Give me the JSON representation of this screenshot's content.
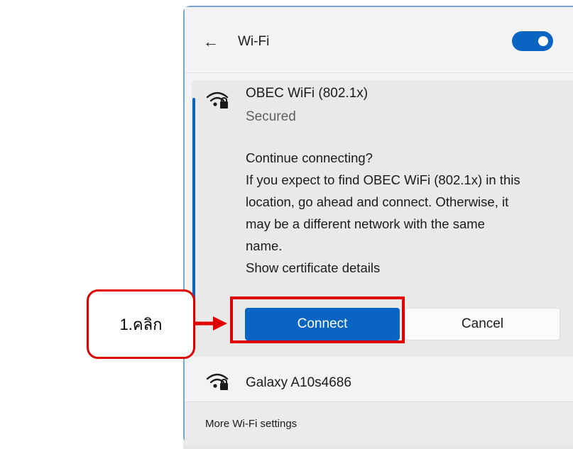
{
  "panel": {
    "title": "Wi-Fi",
    "back_icon": "back-arrow-icon",
    "toggle": {
      "state": "on",
      "icon": "toggle-switch"
    }
  },
  "networks": [
    {
      "name": "OBEC WiFi (802.1x)",
      "status": "Secured",
      "icon": "wifi-secured-icon",
      "expanded": true,
      "message_lines": [
        "Continue connecting?",
        "If you expect to find OBEC WiFi (802.1x) in this",
        "location, go ahead and connect. Otherwise, it",
        "may be a different network with the same",
        "name.",
        "Show certificate details"
      ],
      "connect_label": "Connect",
      "cancel_label": "Cancel"
    },
    {
      "name": "Galaxy A10s4686",
      "icon": "wifi-secured-icon"
    }
  ],
  "footer": {
    "link_label": "More Wi-Fi settings"
  },
  "annotation": {
    "callout_text": "1.คลิก",
    "color": "#e00000"
  },
  "colors": {
    "accent": "#0a64c2",
    "panel_bg": "#f3f3f3",
    "card_bg": "#e9e9e9"
  }
}
